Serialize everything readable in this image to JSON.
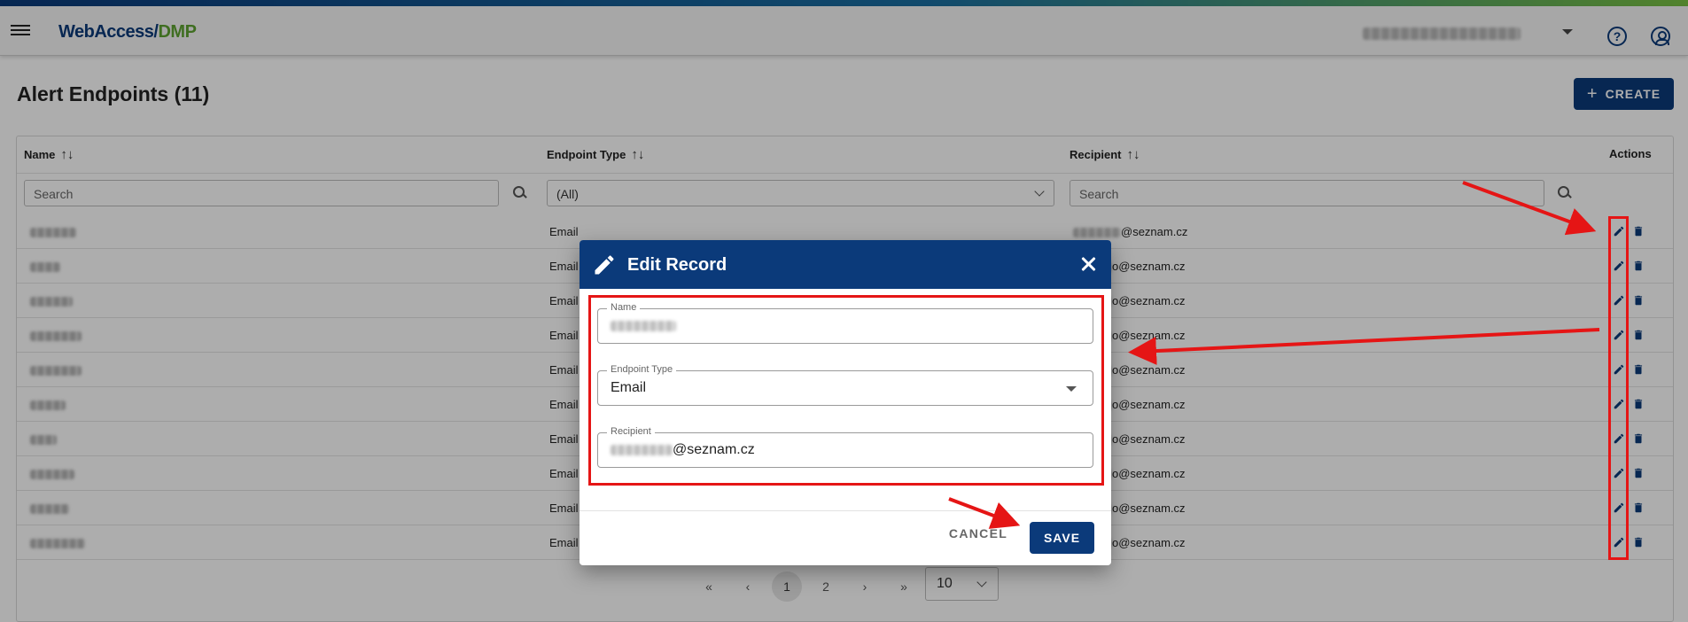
{
  "app": {
    "logo_part1": "WebAccess/",
    "logo_part2": "DMP",
    "help_glyph": "?",
    "colors": {
      "primary": "#0b3a7a",
      "accent_green": "#79c142",
      "annotation_red": "#e51515"
    }
  },
  "page": {
    "title": "Alert Endpoints (11)",
    "create_plus": "+",
    "create_label": "CREATE"
  },
  "table": {
    "columns": {
      "name": "Name",
      "type": "Endpoint Type",
      "recipient": "Recipient",
      "actions": "Actions"
    },
    "sort_glyph": "↑↓",
    "filters": {
      "name_placeholder": "Search",
      "type_value": "(All)",
      "recipient_placeholder": "Search"
    },
    "rows": [
      {
        "type": "Email",
        "recipient_suffix": "@seznam.cz"
      },
      {
        "type": "Email",
        "recipient_suffix": "o@seznam.cz"
      },
      {
        "type": "Email",
        "recipient_suffix": "o@seznam.cz"
      },
      {
        "type": "Email",
        "recipient_suffix": "o@seznam.cz"
      },
      {
        "type": "Email",
        "recipient_suffix": "o@seznam.cz"
      },
      {
        "type": "Email",
        "recipient_suffix": "o@seznam.cz"
      },
      {
        "type": "Email",
        "recipient_suffix": "o@seznam.cz"
      },
      {
        "type": "Email",
        "recipient_suffix": "o@seznam.cz"
      },
      {
        "type": "Email",
        "recipient_suffix": "o@seznam.cz"
      },
      {
        "type": "Email",
        "recipient_suffix": "o@seznam.cz"
      }
    ]
  },
  "pagination": {
    "first": "«",
    "prev": "‹",
    "pages": [
      "1",
      "2"
    ],
    "next": "›",
    "last": "»",
    "page_size": "10"
  },
  "dialog": {
    "title": "Edit Record",
    "fields": {
      "name_label": "Name",
      "type_label": "Endpoint Type",
      "type_value": "Email",
      "recipient_label": "Recipient",
      "recipient_suffix": "@seznam.cz"
    },
    "cancel_label": "CANCEL",
    "save_label": "SAVE"
  }
}
